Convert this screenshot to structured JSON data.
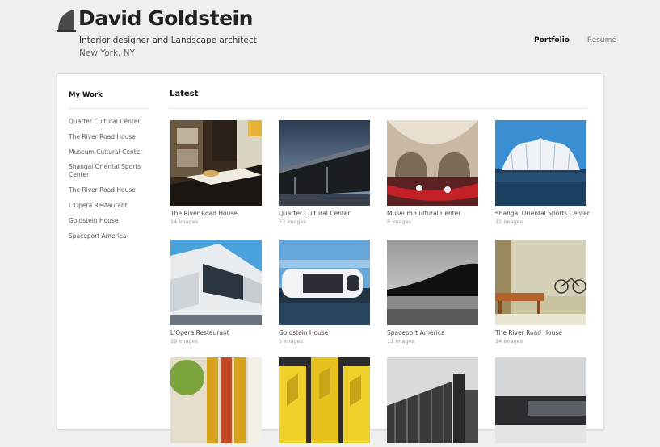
{
  "header": {
    "title": "David Goldstein",
    "tagline": "Interior designer and Landscape architect",
    "location": "New York, NY",
    "nav": [
      {
        "label": "Portfolio",
        "active": true
      },
      {
        "label": "Resumé",
        "active": false
      }
    ]
  },
  "sidebar": {
    "heading": "My Work",
    "items": [
      {
        "label": "Quarter Cultural Center"
      },
      {
        "label": "The River Road House"
      },
      {
        "label": "Museum Cultural Center"
      },
      {
        "label": "Shangai Oriental Sports Center"
      },
      {
        "label": "The River Road House"
      },
      {
        "label": "L'Opera Restaurant"
      },
      {
        "label": "Goldstein House"
      },
      {
        "label": "Spaceport America"
      }
    ]
  },
  "main": {
    "heading": "Latest",
    "projects": [
      {
        "title": "The River Road House",
        "count": "14 images"
      },
      {
        "title": "Quarter Cultural Center",
        "count": "22 images"
      },
      {
        "title": "Museum Cultural Center",
        "count": "8 images"
      },
      {
        "title": "Shangai Oriental Sports Center",
        "count": "12 images"
      },
      {
        "title": "L'Opera Restaurant",
        "count": "19 images"
      },
      {
        "title": "Goldstein House",
        "count": "5 images"
      },
      {
        "title": "Spaceport America",
        "count": "11 images"
      },
      {
        "title": "The River Road House",
        "count": "14 images"
      },
      {
        "title": "",
        "count": ""
      },
      {
        "title": "",
        "count": ""
      },
      {
        "title": "",
        "count": ""
      },
      {
        "title": "",
        "count": ""
      }
    ]
  },
  "colors": {
    "background": "#efefef",
    "card": "#ffffff",
    "text": "#222222"
  }
}
